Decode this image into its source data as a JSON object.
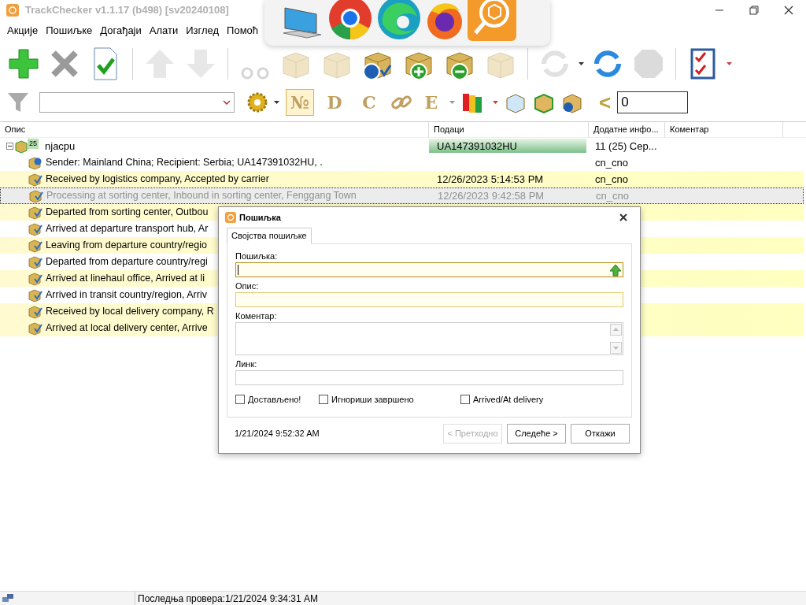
{
  "window": {
    "title": "TrackChecker v1.1.17 (b498)  [sv20240108]"
  },
  "menu": [
    "Акције",
    "Пошиљке",
    "Догађаји",
    "Алати",
    "Изглед",
    "Помоћ"
  ],
  "filter_bar": {
    "letter_buttons": [
      {
        "label": "№",
        "selected": true
      },
      {
        "label": "D",
        "selected": false
      },
      {
        "label": "C",
        "selected": false
      }
    ],
    "extra_letter": {
      "label": "E"
    },
    "compare": {
      "label": "<",
      "value": "0"
    }
  },
  "table": {
    "columns": [
      "Опис",
      "Подаци",
      "Додатне инфо...",
      "Коментар"
    ],
    "rows": [
      {
        "description": "njacpu",
        "badge": "25",
        "data": "UA147391032HU",
        "extra": "11 (25) Сер...",
        "expanded": true,
        "children": [
          {
            "kind": "info",
            "description": "Sender: Mainland China; Recipient: Serbia; UA147391032HU, .",
            "extra": "cn_cno",
            "highlight": false,
            "selected": false
          },
          {
            "kind": "event",
            "description": "Received by logistics company, Accepted by carrier",
            "data": "12/26/2023 5:14:53 PM",
            "extra": "cn_cno",
            "highlight": true,
            "selected": false
          },
          {
            "kind": "event",
            "description": "Processing at sorting center, Inbound in sorting center, Fenggang Town",
            "data": "12/26/2023 9:42:58 PM",
            "extra": "cn_cno",
            "highlight": false,
            "selected": true
          },
          {
            "kind": "event",
            "description": "Departed from sorting center, Outbou",
            "highlight": true,
            "selected": false
          },
          {
            "kind": "event",
            "description": "Arrived at departure transport hub, Ar",
            "highlight": false,
            "selected": false
          },
          {
            "kind": "event",
            "description": "Leaving from departure country/regio",
            "highlight": true,
            "selected": false
          },
          {
            "kind": "event",
            "description": "Departed from departure country/regi",
            "highlight": false,
            "selected": false
          },
          {
            "kind": "event",
            "description": "Arrived at linehaul office, Arrived at li",
            "highlight": true,
            "selected": false
          },
          {
            "kind": "event",
            "description": "Arrived in transit country/region, Arriv",
            "highlight": false,
            "selected": false
          },
          {
            "kind": "event",
            "description": "Received by local delivery company, R",
            "highlight": true,
            "selected": false
          },
          {
            "kind": "event",
            "description": "Arrived at local delivery center, Arrive",
            "highlight": true,
            "selected": false
          }
        ]
      }
    ]
  },
  "dialog": {
    "title": "Пошиљка",
    "tabs": [
      {
        "label": "Својства пошиљке",
        "selected": true
      }
    ],
    "fields": [
      {
        "label": "Пошиљка:",
        "kind": "input",
        "required": true,
        "focused": true
      },
      {
        "label": "Опис:",
        "kind": "input",
        "required": true,
        "focused": false
      },
      {
        "label": "Коментар:",
        "kind": "textarea",
        "required": false,
        "focused": false
      },
      {
        "label": "Линк:",
        "kind": "input",
        "required": false,
        "focused": false
      }
    ],
    "checkboxes": [
      {
        "label": "Достављено!",
        "checked": false
      },
      {
        "label": "Игнориши завршено",
        "checked": false
      },
      {
        "label": "Arrived/At delivery",
        "checked": false
      }
    ],
    "timestamp": "1/21/2024 9:52:32 AM",
    "buttons": [
      {
        "label": "< Претходно",
        "disabled": true
      },
      {
        "label": "Следеће >",
        "disabled": false
      },
      {
        "label": "Откажи",
        "disabled": false
      }
    ]
  },
  "status_bar": {
    "text": "Последња провера:1/21/2024 9:34:31 AM"
  }
}
